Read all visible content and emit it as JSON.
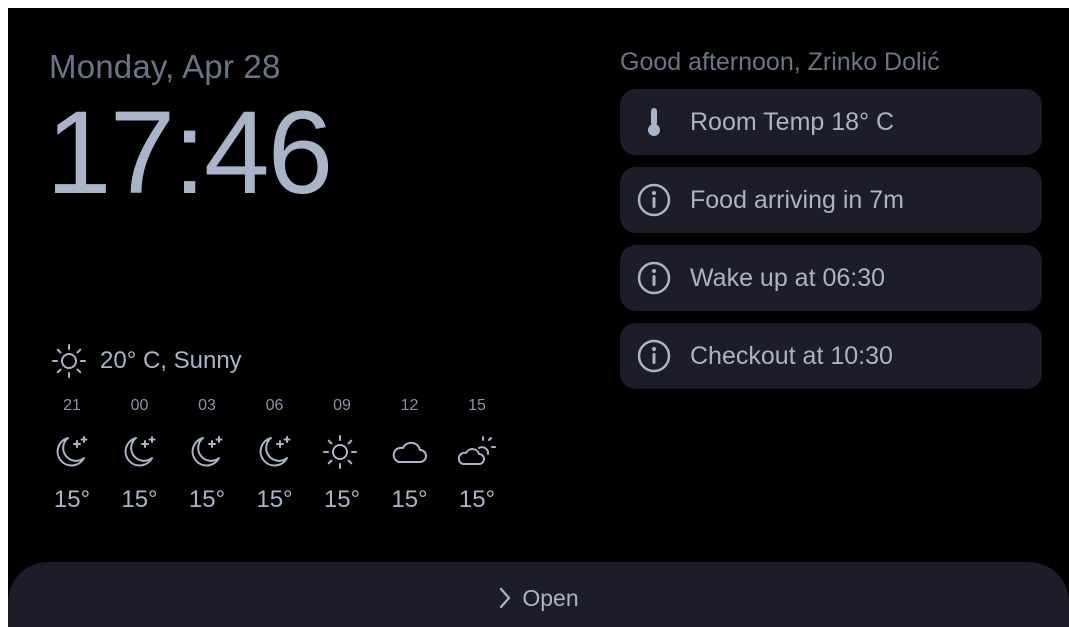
{
  "header": {
    "date": "Monday, Apr 28",
    "time": "17:46",
    "greeting": "Good afternoon, Zrinko Dolić"
  },
  "cards": [
    {
      "icon": "thermometer-icon",
      "text": "Room Temp 18° C"
    },
    {
      "icon": "info-icon",
      "text": "Food arriving in 7m"
    },
    {
      "icon": "info-icon",
      "text": "Wake up at 06:30"
    },
    {
      "icon": "info-icon",
      "text": "Checkout at 10:30"
    }
  ],
  "weather": {
    "current_icon": "sun-icon",
    "current_text": "20° C, Sunny",
    "forecast": [
      {
        "hour": "21",
        "icon": "moon-stars-icon",
        "temp": "15°"
      },
      {
        "hour": "00",
        "icon": "moon-stars-icon",
        "temp": "15°"
      },
      {
        "hour": "03",
        "icon": "moon-stars-icon",
        "temp": "15°"
      },
      {
        "hour": "06",
        "icon": "moon-stars-icon",
        "temp": "15°"
      },
      {
        "hour": "09",
        "icon": "sun-icon",
        "temp": "15°"
      },
      {
        "hour": "12",
        "icon": "cloud-icon",
        "temp": "15°"
      },
      {
        "hour": "15",
        "icon": "cloud-sun-icon",
        "temp": "15°"
      }
    ]
  },
  "footer": {
    "open_icon": "chevron-right-icon",
    "open_label": "Open"
  },
  "colors": {
    "background": "#000000",
    "card": "#1c1d28",
    "text_primary": "#aab4c8",
    "text_secondary": "#6b7487"
  }
}
